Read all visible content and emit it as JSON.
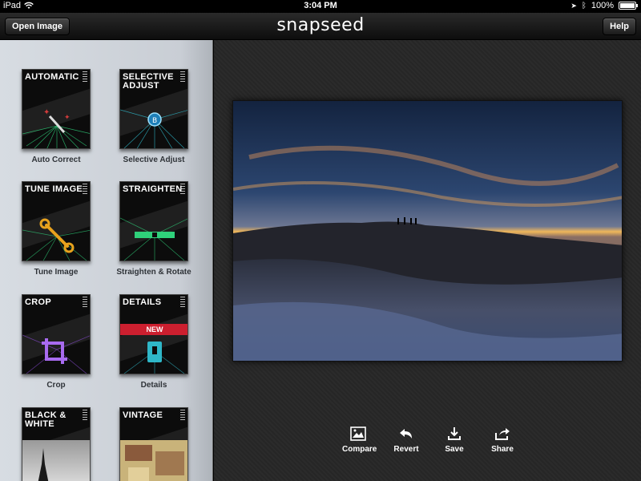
{
  "status_bar": {
    "device": "iPad",
    "time": "3:04 PM",
    "battery": "100%"
  },
  "top_bar": {
    "open_label": "Open Image",
    "logo": "snapseed",
    "help_label": "Help"
  },
  "tools": [
    {
      "title_line1": "AUTOMATIC",
      "title_line2": "",
      "label": "Auto Correct",
      "badge": ""
    },
    {
      "title_line1": "SELECTIVE",
      "title_line2": "ADJUST",
      "label": "Selective Adjust",
      "badge": ""
    },
    {
      "title_line1": "TUNE IMAGE",
      "title_line2": "",
      "label": "Tune Image",
      "badge": ""
    },
    {
      "title_line1": "STRAIGHTEN",
      "title_line2": "",
      "label": "Straighten & Rotate",
      "badge": ""
    },
    {
      "title_line1": "CROP",
      "title_line2": "",
      "label": "Crop",
      "badge": ""
    },
    {
      "title_line1": "DETAILS",
      "title_line2": "",
      "label": "Details",
      "badge": "NEW"
    },
    {
      "title_line1": "BLACK &",
      "title_line2": "WHITE",
      "label": "",
      "badge": ""
    },
    {
      "title_line1": "VINTAGE",
      "title_line2": "",
      "label": "",
      "badge": ""
    }
  ],
  "actions": {
    "compare": "Compare",
    "revert": "Revert",
    "save": "Save",
    "share": "Share"
  },
  "colors": {
    "accent_new": "#cc1f2f",
    "tool_green": "#2fd07a",
    "tool_purple": "#8a4bd6",
    "tool_teal": "#2fb7c8"
  }
}
